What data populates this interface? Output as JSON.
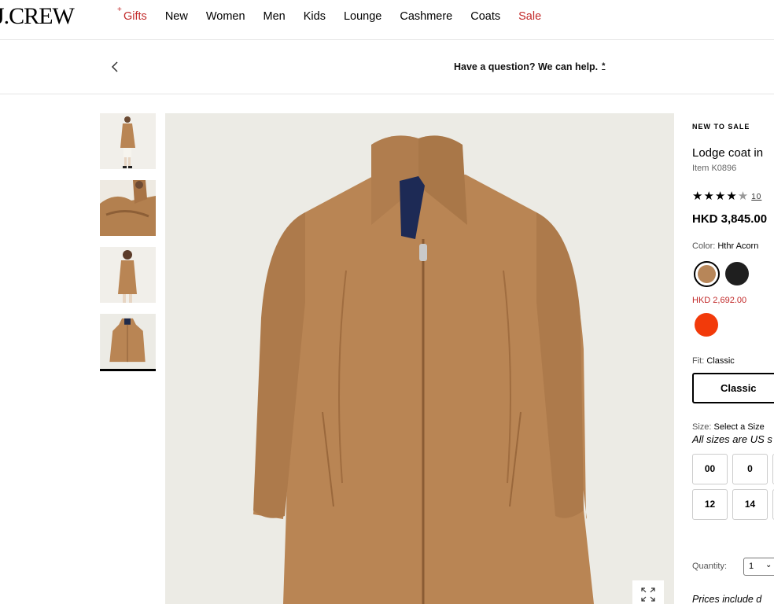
{
  "header": {
    "logo": "J.CREW",
    "nav": [
      {
        "label": "Gifts",
        "red": true,
        "plus": "+"
      },
      {
        "label": "New"
      },
      {
        "label": "Women"
      },
      {
        "label": "Men"
      },
      {
        "label": "Kids"
      },
      {
        "label": "Lounge"
      },
      {
        "label": "Cashmere"
      },
      {
        "label": "Coats"
      },
      {
        "label": "Sale",
        "red": true
      }
    ]
  },
  "helpbar": {
    "back_icon": "chevron-left-icon",
    "text": "Have a question? We can help.",
    "marker": "*"
  },
  "gallery": {
    "thumbnail_count": 4,
    "active_thumbnail": 4,
    "expand_icon": "expand-icon"
  },
  "product": {
    "badge": "NEW TO SALE",
    "title": "Lodge coat in",
    "item_number": "Item K0896",
    "rating_stars": "★★★★",
    "rating_half": "★",
    "rating_value": 4.5,
    "review_count": "10",
    "price": "HKD 3,845.00",
    "color_label": "Color:",
    "color_value": "Hthr Acorn",
    "swatches": [
      {
        "name": "Hthr Acorn",
        "hex": "#b78659",
        "selected": true
      },
      {
        "name": "Black",
        "hex": "#1f1f1f",
        "selected": false
      }
    ],
    "sale_price": "HKD 2,692.00",
    "sale_swatches": [
      {
        "name": "Red",
        "hex": "#f23a0a"
      }
    ],
    "fit_label": "Fit:",
    "fit_value": "Classic",
    "fit_button": "Classic",
    "size_label": "Size:",
    "size_value": "Select a Size",
    "size_note": "All sizes are US s",
    "sizes_row1": [
      "00",
      "0"
    ],
    "sizes_row2": [
      "12",
      "14"
    ],
    "quantity_label": "Quantity:",
    "quantity_value": "1",
    "prices_note": "Prices include d"
  },
  "colors": {
    "accent_red": "#c22a2a",
    "coat": "#b98554",
    "background": "#ecebe5"
  }
}
